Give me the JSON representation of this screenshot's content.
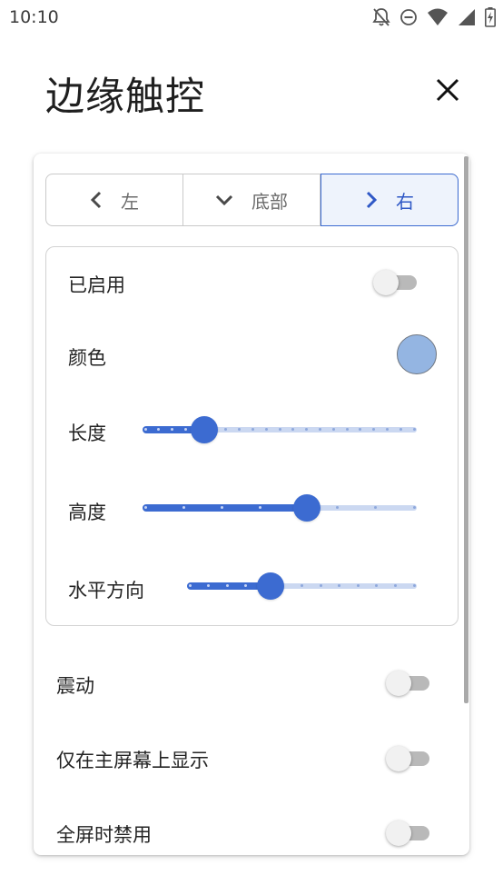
{
  "status_bar": {
    "time": "10:10",
    "icons": [
      "notifications-off-icon",
      "do-not-disturb-icon",
      "wifi-icon",
      "signal-icon",
      "battery-charging-icon"
    ]
  },
  "header": {
    "title": "边缘触控",
    "close_icon": "close-icon"
  },
  "position_tabs": {
    "items": [
      {
        "label": "左",
        "icon": "chevron-left-icon",
        "selected": false
      },
      {
        "label": "底部",
        "icon": "chevron-down-icon",
        "selected": false
      },
      {
        "label": "右",
        "icon": "chevron-right-icon",
        "selected": true
      }
    ]
  },
  "edge_settings": {
    "enabled": {
      "label": "已启用",
      "value": false
    },
    "color": {
      "label": "颜色",
      "value": "#94b5e2"
    },
    "length": {
      "label": "长度",
      "value": 0.22,
      "steps": 20
    },
    "height": {
      "label": "高度",
      "value": 0.6,
      "steps": 7
    },
    "horizontal": {
      "label": "水平方向",
      "value": 0.36,
      "steps": 12
    }
  },
  "options": {
    "vibration": {
      "label": "震动",
      "value": false
    },
    "home_only": {
      "label": "仅在主屏幕上显示",
      "value": false
    },
    "disable_fullscreen": {
      "label": "全屏时禁用",
      "value": false
    }
  },
  "colors": {
    "accent": "#3c6bd1",
    "accent_light": "#cbd8f1",
    "selected_tab_bg": "#eef3fc"
  }
}
